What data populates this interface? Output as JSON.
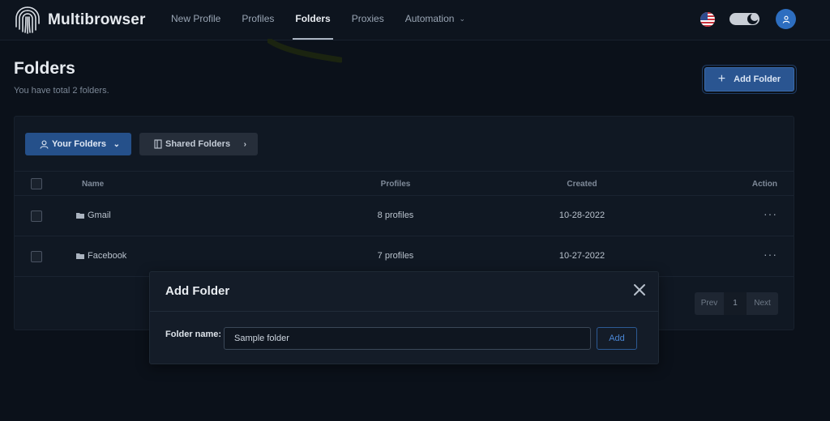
{
  "brand": {
    "name": "Multibrowser",
    "logo_icon": "fingerprint-icon"
  },
  "nav": {
    "items": [
      {
        "label": "New Profile",
        "active": false
      },
      {
        "label": "Profiles",
        "active": false
      },
      {
        "label": "Folders",
        "active": true
      },
      {
        "label": "Proxies",
        "active": false
      },
      {
        "label": "Automation",
        "active": false,
        "has_dropdown": true
      }
    ]
  },
  "header_icons": [
    "us-flag-icon",
    "theme-toggle",
    "user-icon"
  ],
  "page": {
    "title": "Folders",
    "subtitle": "You have total 2 folders.",
    "add_button_label": "Add Folder"
  },
  "tabs": {
    "your_folders": "Your Folders",
    "shared_folders": "Shared Folders"
  },
  "table": {
    "columns": [
      "Name",
      "Profiles",
      "Created",
      "Action"
    ],
    "rows": [
      {
        "name": "Gmail",
        "profiles": "8 profiles",
        "created": "10-28-2022"
      },
      {
        "name": "Facebook",
        "profiles": "7 profiles",
        "created": "10-27-2022"
      }
    ]
  },
  "pagination": {
    "prev": "Prev",
    "page": "1",
    "next": "Next"
  },
  "modal": {
    "title": "Add Folder",
    "label": "Folder name:",
    "input_value": "Sample folder",
    "submit_label": "Add"
  },
  "colors": {
    "accent": "#2a5591",
    "background": "#0b111a",
    "card": "#101823"
  }
}
